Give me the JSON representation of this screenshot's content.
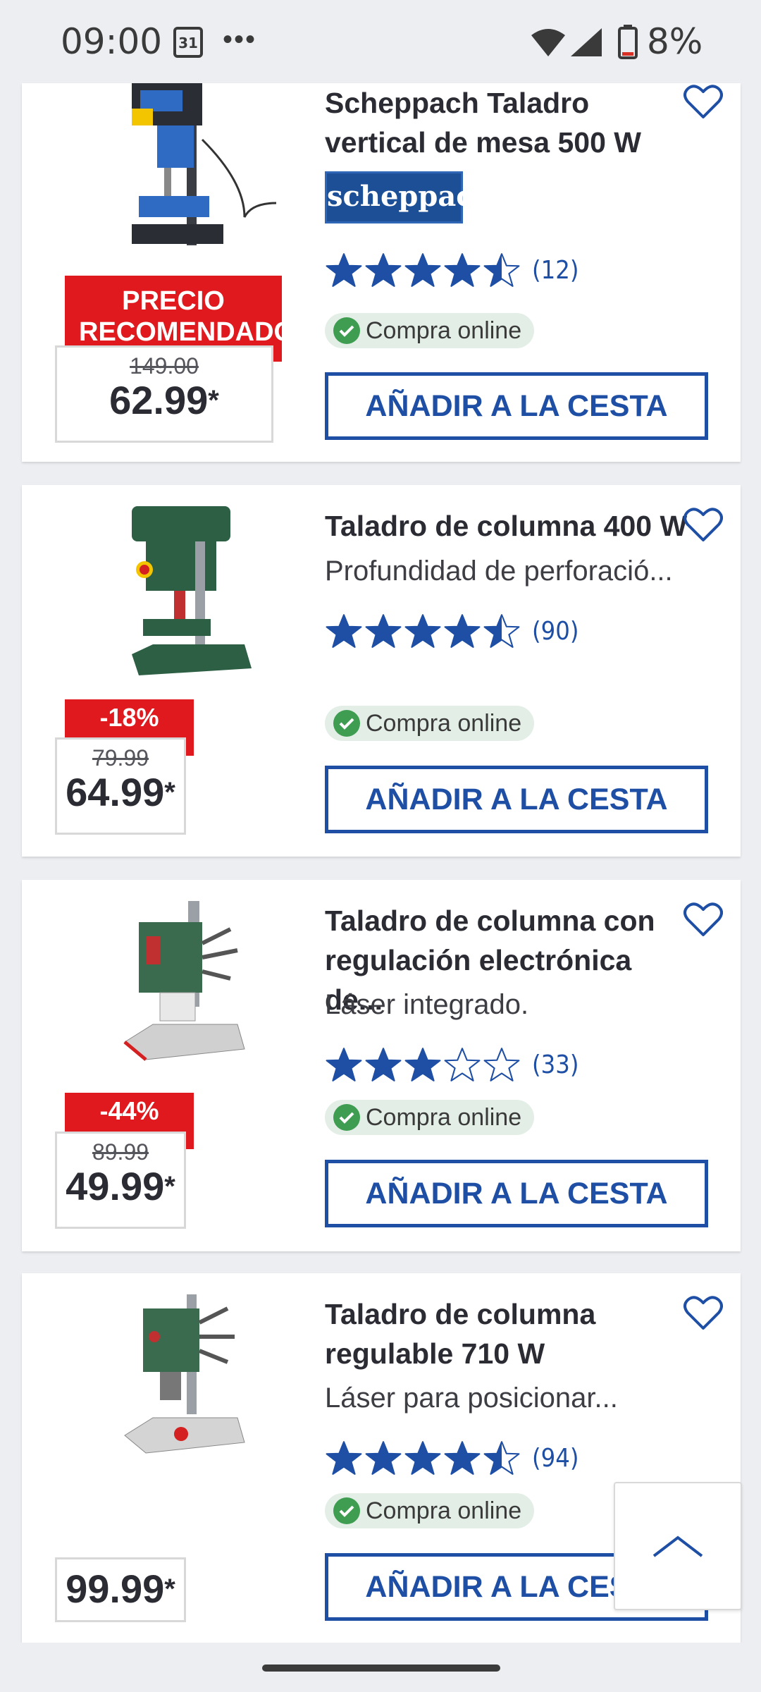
{
  "status_bar": {
    "time": "09:00",
    "calendar_day": "31",
    "dots": "•••",
    "battery_pct": "8%",
    "battery_level": 0.08
  },
  "products": [
    {
      "title": "Scheppach Taladro vertical de mesa 500 W",
      "brand_logo_text": "scheppach",
      "rating": 4.5,
      "rating_count": "(12)",
      "online_label": "Compra online",
      "badge": "PRECIO RECOMENDADO",
      "old_price": "149.00",
      "price": "62.99",
      "price_suffix": "*",
      "button": "AÑADIR A LA CESTA"
    },
    {
      "title": "Taladro de columna 400 W",
      "subtitle": "Profundidad de perforació...",
      "rating": 4.5,
      "rating_count": "(90)",
      "online_label": "Compra online",
      "badge": "-18%",
      "old_price": "79.99",
      "price": "64.99",
      "price_suffix": "*",
      "button": "AÑADIR A LA CESTA"
    },
    {
      "title": "Taladro de columna con regulación electrónica de...",
      "subtitle": "Láser integrado.",
      "rating": 3,
      "rating_count": "(33)",
      "online_label": "Compra online",
      "badge": "-44%",
      "old_price": "89.99",
      "price": "49.99",
      "price_suffix": "*",
      "button": "AÑADIR A LA CESTA"
    },
    {
      "title": "Taladro de columna regulable 710 W",
      "subtitle": "Láser para posicionar...",
      "rating": 4.5,
      "rating_count": "(94)",
      "online_label": "Compra online",
      "price": "99.99",
      "price_suffix": "*",
      "button": "AÑADIR A LA CESTA"
    }
  ],
  "colors": {
    "accent": "#1e4fa5",
    "badge": "#e0191e",
    "online_bg": "#e3eee6",
    "check": "#3f9d52"
  },
  "icons": [
    "heart-icon",
    "star-icon",
    "check-icon",
    "chevron-up-icon",
    "wifi-icon",
    "signal-icon",
    "battery-icon",
    "calendar-icon"
  ]
}
